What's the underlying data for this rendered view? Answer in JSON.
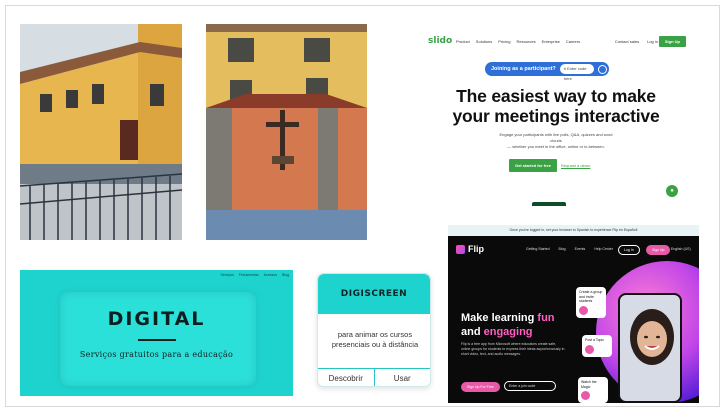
{
  "slido": {
    "logo": "slido",
    "nav": [
      "Product",
      "Solutions",
      "Pricing",
      "Resources",
      "Enterprise",
      "Careers"
    ],
    "nav_right": [
      "Contact sales",
      "Log in"
    ],
    "signup": "Sign Up",
    "pill_label": "Joining as a participant?",
    "code_placeholder": "# Enter code here",
    "headline_1": "The easiest way to make",
    "headline_2": "your meetings interactive",
    "sub_1": "Engage your participants with live polls, Q&A, quizzes and word clouds",
    "sub_2": "— whether you meet in the office, online or in-between.",
    "cta": "Get started for free",
    "demo": "Request a demo",
    "accent": "#3aa244"
  },
  "flip": {
    "banner": "Once you've logged in, set your browser to Spanish to experience Flip en Español!",
    "logo": "Flip",
    "nav": [
      "Getting Started",
      "Blog",
      "Events",
      "Help Center"
    ],
    "login": "Log In",
    "signup": "Sign Up",
    "lang": "English (US)",
    "headline_1": "Make learning ",
    "headline_hl_1": "fun",
    "headline_2": "and ",
    "headline_hl_2": "engaging",
    "sub": "Flip is a free app from Microsoft where educators create safe, online groups for students to express their ideas asynchronously in short video, text, and audio messages.",
    "cta": "Sign Up For Free",
    "join_placeholder": "Enter a join code",
    "steps": [
      "Create a group and invite students",
      "Post a Topic",
      "Watch the Magic"
    ],
    "accent": "#e85aa8"
  },
  "digital": {
    "nav": [
      "Serviços",
      "Ferramentas",
      "Acessos",
      "Blog"
    ],
    "title": "DIGITAL",
    "subtitle": "Serviços gratuitos para a educação"
  },
  "digiscreen": {
    "title": "DIGISCREEN",
    "text": "para animar os cursos presenciais ou à distância",
    "btn_discover": "Descobrir",
    "btn_use": "Usar"
  }
}
